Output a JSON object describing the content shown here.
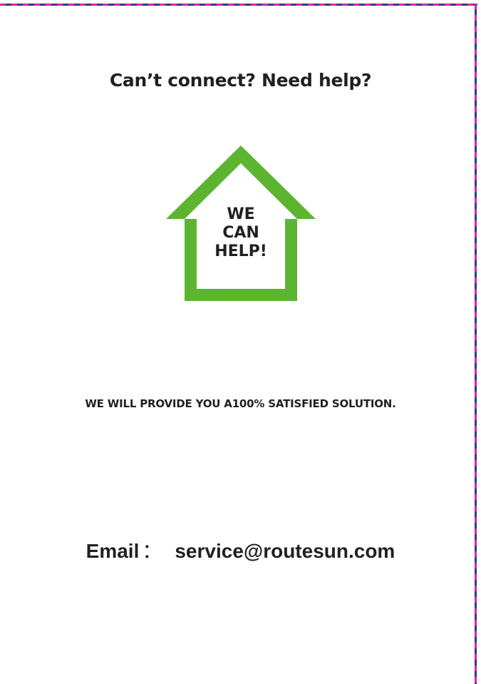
{
  "header": {
    "title": "Can’t connect? Need help?"
  },
  "badge": {
    "icon": "house-icon",
    "color": "#5cb531",
    "lines": [
      "WE",
      "CAN",
      "HELP!"
    ]
  },
  "tagline": "WE WILL PROVIDE YOU A100% SATISFIED SOLUTION.",
  "contact": {
    "label": "Email",
    "separator": "：",
    "address": "service@routesun.com"
  },
  "colors": {
    "text": "#231f20",
    "border_pink": "#e2268f",
    "border_blue": "#2a3d8f"
  }
}
